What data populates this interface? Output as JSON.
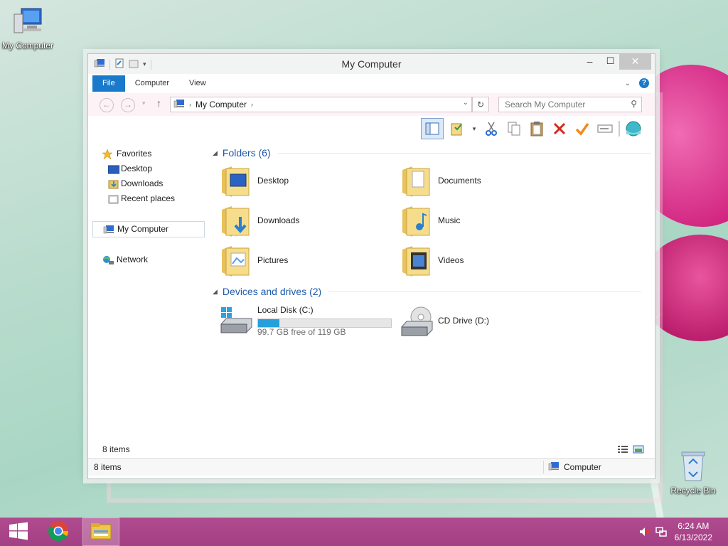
{
  "desktop": {
    "icons": [
      {
        "label": "My Computer"
      },
      {
        "label": "Recycle Bin"
      }
    ]
  },
  "window": {
    "title": "My Computer",
    "controls": {
      "minimize": "–",
      "maximize": "☐",
      "close": "✕"
    },
    "ribbon_tabs": [
      "File",
      "Computer",
      "View"
    ],
    "address": {
      "crumb": "My Computer"
    },
    "search": {
      "placeholder": "Search My Computer"
    },
    "nav_pane": {
      "favorites_label": "Favorites",
      "favorites": [
        "Desktop",
        "Downloads",
        "Recent places"
      ],
      "my_computer": "My Computer",
      "network": "Network"
    },
    "groups": {
      "folders_header": "Folders (6)",
      "drives_header": "Devices and drives (2)"
    },
    "folders": [
      "Desktop",
      "Documents",
      "Downloads",
      "Music",
      "Pictures",
      "Videos"
    ],
    "drives": [
      {
        "name": "Local Disk (C:)",
        "free_text": "99.7 GB free of 119 GB",
        "used_fraction": 0.16
      },
      {
        "name": "CD Drive (D:)"
      }
    ],
    "item_count": "8 items",
    "statusbar": {
      "left": "8 items",
      "right": "Computer"
    }
  },
  "taskbar": {
    "time": "6:24 AM",
    "date": "6/13/2022"
  },
  "colors": {
    "accent": "#1979ca",
    "taskbar": "#a94388",
    "progress": "#26a0da"
  }
}
